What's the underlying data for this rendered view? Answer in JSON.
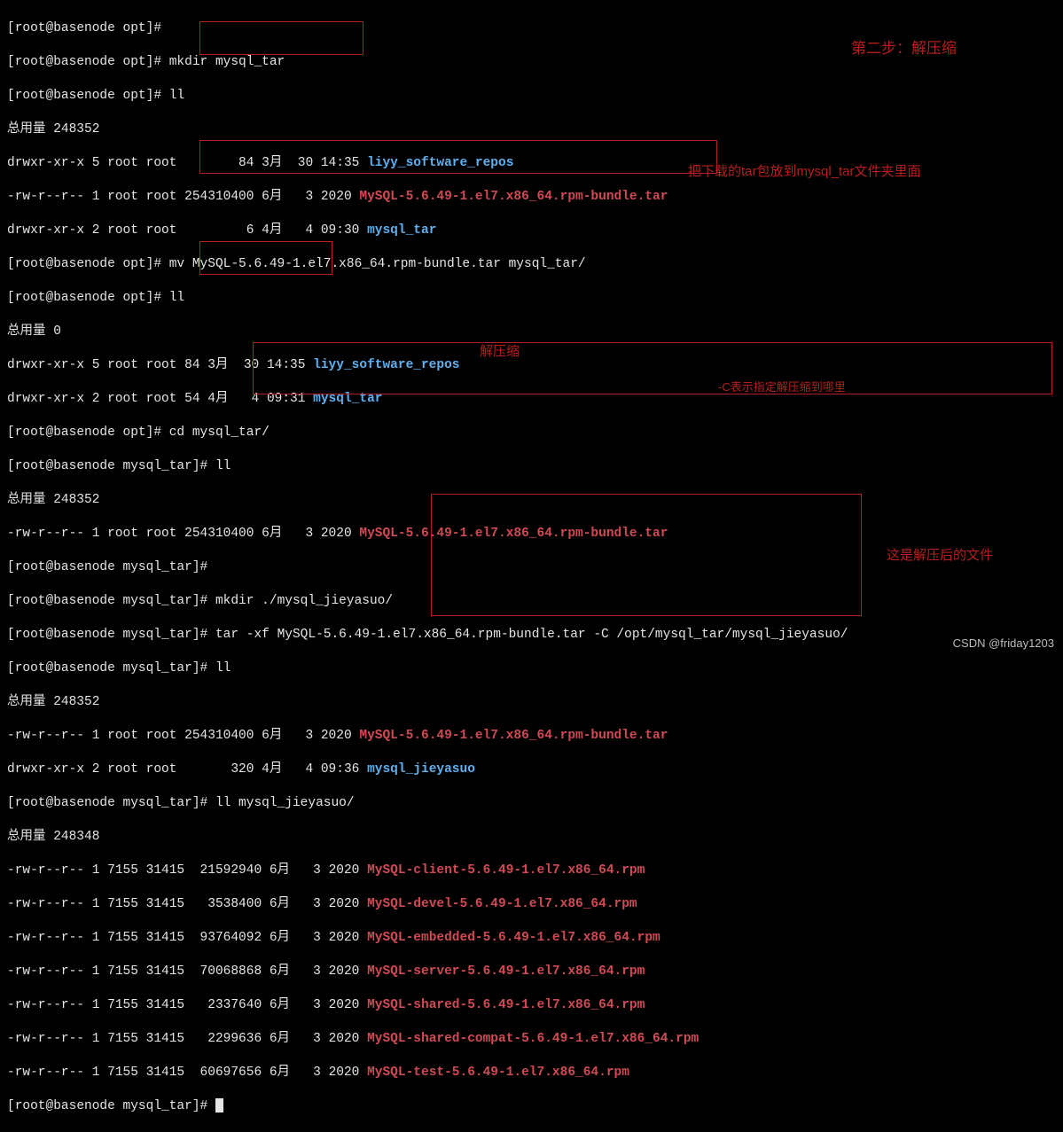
{
  "prompts": {
    "opt": "[root@basenode opt]# ",
    "tar": "[root@basenode mysql_tar]# "
  },
  "cmds": {
    "mkdir": "mkdir mysql_tar",
    "ll": "ll",
    "mv": "mv MySQL-5.6.49-1.el7.x86_64.rpm-bundle.tar mysql_tar/",
    "cd": "cd mysql_tar/",
    "mkdir2": "mkdir ./mysql_jieyasuo/",
    "tarxf": "tar -xf MySQL-5.6.49-1.el7.x86_64.rpm-bundle.tar -C /opt/mysql_tar/mysql_jieyasuo/",
    "lljy": "ll mysql_jieyasuo/"
  },
  "totals": {
    "t1": "总用量 248352",
    "t2": "总用量 0",
    "t3": "总用量 248352",
    "t4": "总用量 248352",
    "t5": "总用量 248348"
  },
  "ls1": {
    "l1a": "drwxr-xr-x 5 root root        84 3月  30 14:35 ",
    "l1a_name": "liyy_software_repos",
    "l1b": "-rw-r--r-- 1 root root 254310400 6月   3 2020 ",
    "l1b_name": "MySQL-5.6.49-1.el7.x86_64.rpm-bundle.tar",
    "l1c": "drwxr-xr-x 2 root root         6 4月   4 09:30 ",
    "l1c_name": "mysql_tar"
  },
  "ls2": {
    "l2a": "drwxr-xr-x 5 root root 84 3月  30 14:35 ",
    "l2a_name": "liyy_software_repos",
    "l2b": "drwxr-xr-x 2 root root 54 4月   4 09:31 ",
    "l2b_name": "mysql_tar"
  },
  "ls3": {
    "l3a": "-rw-r--r-- 1 root root 254310400 6月   3 2020 ",
    "l3a_name": "MySQL-5.6.49-1.el7.x86_64.rpm-bundle.tar"
  },
  "ls4": {
    "l4a": "-rw-r--r-- 1 root root 254310400 6月   3 2020 ",
    "l4a_name": "MySQL-5.6.49-1.el7.x86_64.rpm-bundle.tar",
    "l4b": "drwxr-xr-x 2 root root       320 4月   4 09:36 ",
    "l4b_name": "mysql_jieyasuo"
  },
  "rpm": {
    "pre": "-rw-r--r-- 1 7155 31415 ",
    "s0": " 21592940 6月   3 2020 ",
    "n0": "MySQL-client-5.6.49-1.el7.x86_64.rpm",
    "s1": "  3538400 6月   3 2020 ",
    "n1": "MySQL-devel-5.6.49-1.el7.x86_64.rpm",
    "s2": " 93764092 6月   3 2020 ",
    "n2": "MySQL-embedded-5.6.49-1.el7.x86_64.rpm",
    "s3": " 70068868 6月   3 2020 ",
    "n3": "MySQL-server-5.6.49-1.el7.x86_64.rpm",
    "s4": "  2337640 6月   3 2020 ",
    "n4": "MySQL-shared-5.6.49-1.el7.x86_64.rpm",
    "s5": "  2299636 6月   3 2020 ",
    "n5": "MySQL-shared-compat-5.6.49-1.el7.x86_64.rpm",
    "s6": " 60697656 6月   3 2020 ",
    "n6": "MySQL-test-5.6.49-1.el7.x86_64.rpm"
  },
  "anno": {
    "step2": "第二步：解压缩",
    "moveTar": "把下载的tar包放到mysql_tar文件夹里面",
    "jyz": "解压缩",
    "cexpl": "-C表示指定解压缩到哪里",
    "after": "这是解压后的文件"
  },
  "watermark": "CSDN @friday1203"
}
